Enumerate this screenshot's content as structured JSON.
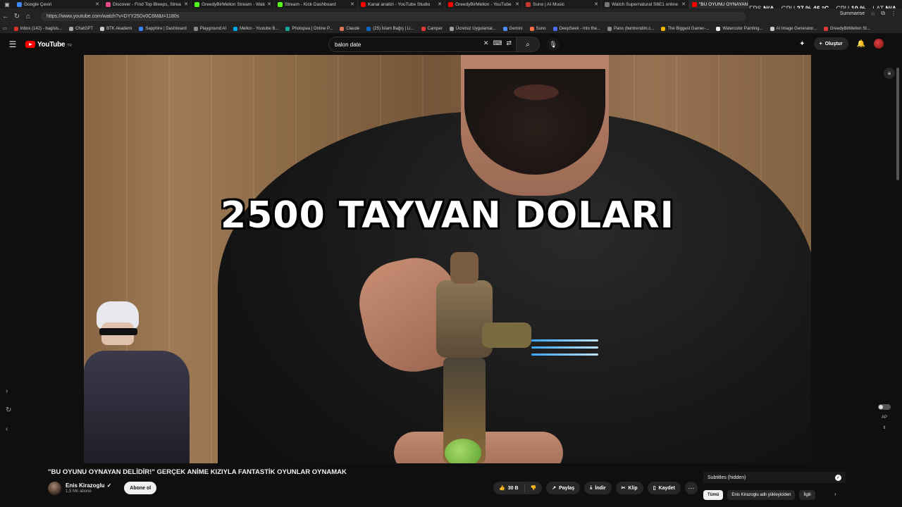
{
  "browser": {
    "tabs": [
      {
        "label": "Google Çeviri",
        "color": "#4285f4"
      },
      {
        "label": "Discover - Find Top Bleeps, Strea",
        "color": "#e04a8a"
      },
      {
        "label": "GreedyBirMellon Stream - Watch",
        "color": "#53fc18"
      },
      {
        "label": "Stream - Kick Dashboard",
        "color": "#53fc18"
      },
      {
        "label": "Kanal analizi - YouTube Studio",
        "color": "#ff0000"
      },
      {
        "label": "GreedyBirMellon - YouTube",
        "color": "#ff0000"
      },
      {
        "label": "Suno | AI Music",
        "color": "#c0392b"
      },
      {
        "label": "Watch Supernatural S6E1 online",
        "color": "#777777"
      },
      {
        "label": "\"BU OYUNU OYNAYAN DELİ",
        "color": "#ff0000",
        "active": true
      }
    ],
    "url": "https://www.youtube.com/watch?v=DYY25Dv0C6M&t=1180s",
    "summarise_label": "Summarise",
    "bookmarks": [
      {
        "label": "Inbox (142) - bagisis...",
        "color": "#d93025"
      },
      {
        "label": "ChatGPT",
        "color": "#aaaaaa"
      },
      {
        "label": "BTK Akademi",
        "color": "#cccccc"
      },
      {
        "label": "Sapphire | Dashboard",
        "color": "#3b82f6"
      },
      {
        "label": "Playground AI",
        "color": "#888888"
      },
      {
        "label": "Mellon - Youtube B...",
        "color": "#00a8e8"
      },
      {
        "label": "Photopea | Online P...",
        "color": "#18a497"
      },
      {
        "label": "Claude",
        "color": "#d97757"
      },
      {
        "label": "(25) İslam Bağış | Li...",
        "color": "#0a66c2"
      },
      {
        "label": "Camper",
        "color": "#e53935"
      },
      {
        "label": "Ücretsiz Uygulamal...",
        "color": "#9e9e9e"
      },
      {
        "label": "Gemini",
        "color": "#4f8cff"
      },
      {
        "label": "Suno",
        "color": "#ff7043"
      },
      {
        "label": "DeepSeek - Into the...",
        "color": "#4d6bfe"
      },
      {
        "label": "Pano (bentrendim.c...",
        "color": "#888888"
      },
      {
        "label": "The Biggest Gamer-...",
        "color": "#f4b400"
      },
      {
        "label": "Watercolor Painting...",
        "color": "#eeeeee"
      },
      {
        "label": "AI Image Generator...",
        "color": "#cccccc"
      },
      {
        "label": "GreedyBirMellon St...",
        "color": "#e53935"
      }
    ]
  },
  "overlay": {
    "fps_label": "FPS",
    "fps_value": "N/A",
    "gpu_label": "GPU",
    "gpu_value": "27 %",
    "gpu_temp": "46 °C",
    "cpu_label": "CPU",
    "cpu_value": "10 %",
    "lat_label": "LAT",
    "lat_value": "N/A"
  },
  "youtube": {
    "logo_text": "YouTube",
    "country_code": "TR",
    "search_value": "balon date",
    "create_label": "Oluştur"
  },
  "video": {
    "caption": "2500 TAYVAN DOLARI"
  },
  "watch": {
    "title": "\"BU OYUNU OYNAYAN DELİDİR!\" GERÇEK ANİME KIZIYLA FANTASTİK OYUNLAR OYNAMAK",
    "channel_name": "Enis Kirazoglu",
    "subscribers": "1,5 Mn abone",
    "subscribe_label": "Abone ol",
    "likes": "30 B",
    "share_label": "Paylaş",
    "download_label": "İndir",
    "clip_label": "Klip",
    "save_label": "Kaydet"
  },
  "sidebar": {
    "subtitles_label": "Subtitles (hidden)",
    "chips": [
      "Tümü",
      "Enis Kirazoglu adlı yükleyiciden",
      "İlgili"
    ],
    "ap_label": "AP"
  }
}
